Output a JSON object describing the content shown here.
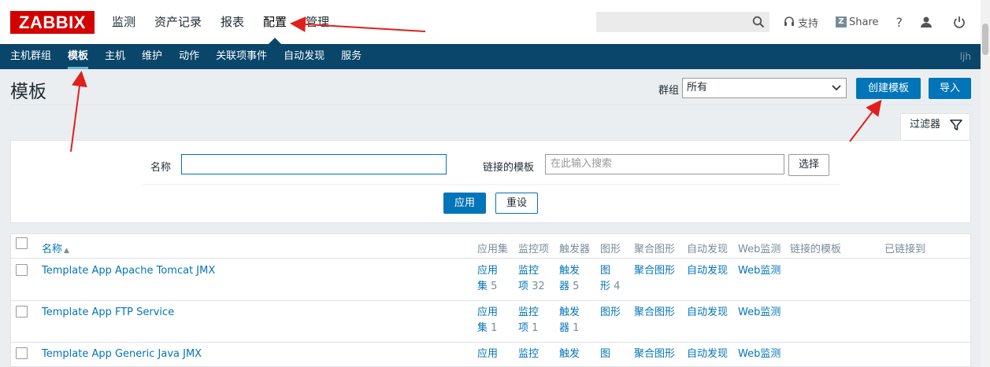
{
  "header": {
    "logo": "ZABBIX",
    "menu": [
      {
        "label": "监测"
      },
      {
        "label": "资产记录"
      },
      {
        "label": "报表"
      },
      {
        "label": "配置"
      },
      {
        "label": "管理"
      }
    ],
    "support": "支持",
    "share": "Share",
    "help": "?"
  },
  "subnav": {
    "items": [
      {
        "label": "主机群组"
      },
      {
        "label": "模板"
      },
      {
        "label": "主机"
      },
      {
        "label": "维护"
      },
      {
        "label": "动作"
      },
      {
        "label": "关联项事件"
      },
      {
        "label": "自动发现"
      },
      {
        "label": "服务"
      }
    ],
    "user": "ljh"
  },
  "page": {
    "title": "模板",
    "group_label": "群组",
    "group_value": "所有",
    "create_button": "创建模板",
    "import_button": "导入"
  },
  "filter": {
    "tab_label": "过滤器",
    "name_label": "名称",
    "name_value": "",
    "linked_label": "链接的模板",
    "linked_placeholder": "在此输入搜索",
    "select_button": "选择",
    "apply_button": "应用",
    "reset_button": "重设"
  },
  "table": {
    "columns": {
      "name": "名称",
      "sort_arrow": "▲",
      "apps": "应用集",
      "items": "监控项",
      "triggers": "触发器",
      "graphs": "图形",
      "screens": "聚合图形",
      "discovery": "自动发现",
      "web": "Web监测",
      "linked_templates": "链接的模板",
      "linked_to": "已链接到"
    },
    "rows": [
      {
        "name": "Template App Apache Tomcat JMX",
        "apps_l1": "应用",
        "apps_l2": "集",
        "apps_count": "5",
        "items_l1": "监控",
        "items_l2": "项",
        "items_count": "32",
        "triggers_l1": "触发",
        "triggers_l2": "器",
        "triggers_count": "5",
        "graphs_l1": "图",
        "graphs_l2": "形",
        "graphs_count": "4",
        "screens": "聚合图形",
        "discovery": "自动发现",
        "web": "Web监测"
      },
      {
        "name": "Template App FTP Service",
        "apps_l1": "应用",
        "apps_l2": "集",
        "apps_count": "1",
        "items_l1": "监控",
        "items_l2": "项",
        "items_count": "1",
        "triggers_l1": "触发",
        "triggers_l2": "器",
        "triggers_count": "1",
        "graphs_l1": "图形",
        "graphs_l2": "",
        "graphs_count": "",
        "screens": "聚合图形",
        "discovery": "自动发现",
        "web": "Web监测"
      },
      {
        "name": "Template App Generic Java JMX",
        "apps_l1": "应用",
        "apps_l2": "",
        "apps_count": "",
        "items_l1": "监控",
        "items_l2": "",
        "items_count": "",
        "triggers_l1": "触发",
        "triggers_l2": "",
        "triggers_count": "",
        "graphs_l1": "图",
        "graphs_l2": "",
        "graphs_count": "",
        "screens": "聚合图形",
        "discovery": "自动发现",
        "web": "Web监测"
      }
    ]
  },
  "colors": {
    "brand": "#d40000",
    "subnav_bg": "#0a466a",
    "link": "#0275b8",
    "annotation_arrow": "#e0201c"
  }
}
